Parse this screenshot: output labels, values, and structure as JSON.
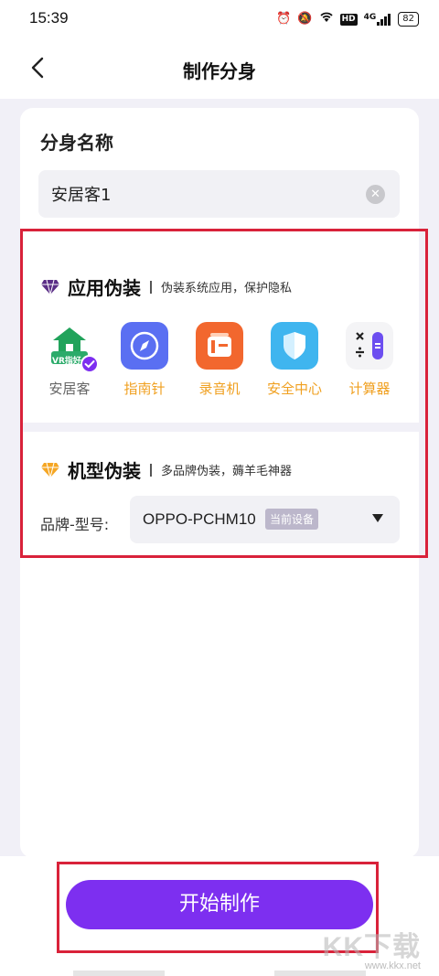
{
  "status_bar": {
    "time": "15:39",
    "network": "4G",
    "hd_badge": "HD",
    "battery": "82"
  },
  "nav": {
    "title": "制作分身"
  },
  "clone_name": {
    "label": "分身名称",
    "value": "安居客1"
  },
  "app_disguise": {
    "title": "应用伪装",
    "subtitle": "伪装系统应用，保护隐私",
    "apps": [
      {
        "name": "安居客",
        "icon": "anjuke-app-icon",
        "icon_text": "VR指好",
        "selected": true
      },
      {
        "name": "指南针",
        "icon": "compass-app-icon"
      },
      {
        "name": "录音机",
        "icon": "recorder-app-icon"
      },
      {
        "name": "安全中心",
        "icon": "security-center-app-icon"
      },
      {
        "name": "计算器",
        "icon": "calculator-app-icon"
      }
    ]
  },
  "model_disguise": {
    "title": "机型伪装",
    "subtitle": "多品牌伪装，薅羊毛神器",
    "brand_label": "品牌-型号:",
    "brand_value": "OPPO-PCHM10",
    "current_badge": "当前设备"
  },
  "start_button": {
    "label": "开始制作"
  },
  "watermark": {
    "main": "KK下载",
    "sub": "www.kkx.net"
  },
  "colors": {
    "accent": "#7d2ff0",
    "app_label_orange": "#f0a020",
    "app_label_gray": "#666666",
    "highlight_red": "#d9223a",
    "page_bg": "#f1f0f7"
  }
}
